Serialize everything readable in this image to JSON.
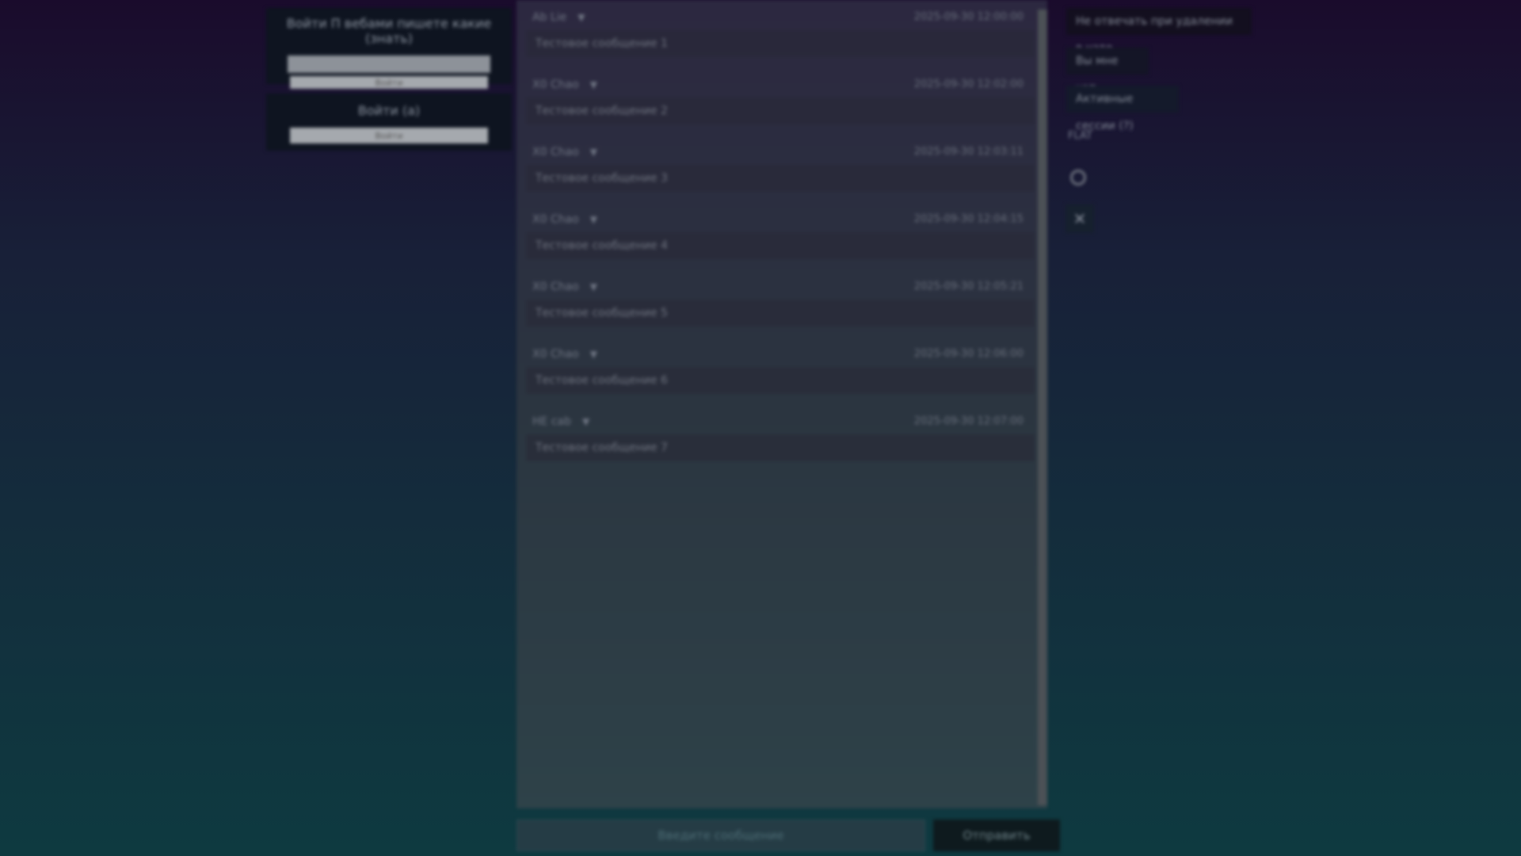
{
  "panel_top": {
    "title": "Войти П вебами пишете какие (знать)",
    "input_placeholder": "",
    "button_label": "Войти"
  },
  "panel_bottom": {
    "title": "Войти (а)",
    "button_label": "Войти"
  },
  "messages": [
    {
      "author": "Ab Lie",
      "time": "2025-09-30 12:00:00",
      "text": "Тестовое сообщение 1"
    },
    {
      "author": "X0 Chao",
      "time": "2025-09-30 12:02:00",
      "text": "Тестовое сообщение 2"
    },
    {
      "author": "X0 Chao",
      "time": "2025-09-30 12:03:11",
      "text": "Тестовое сообщение 3"
    },
    {
      "author": "X0 Chao",
      "time": "2025-09-30 12:04:15",
      "text": "Тестовое сообщение 4"
    },
    {
      "author": "X0 Chao",
      "time": "2025-09-30 12:05:21",
      "text": "Тестовое сообщение 5"
    },
    {
      "author": "X0 Chao",
      "time": "2025-09-30 12:06:00",
      "text": "Тестовое сообщение 6"
    },
    {
      "author": "HE cab",
      "time": "2025-09-30 12:07:00",
      "text": "Тестовое сообщение 7"
    }
  ],
  "composer": {
    "placeholder": "Введите сообщение",
    "send_label": "Отправить"
  },
  "side": {
    "btn1": "Не отвечать при удалении в чате",
    "btn2": "Вы мне чат",
    "btn3": "Активные сессии (?)",
    "flat_label": "FLAT"
  },
  "icons": {
    "circle": "circle-icon",
    "close": "close-icon",
    "arrow": "triangle-down-icon"
  }
}
